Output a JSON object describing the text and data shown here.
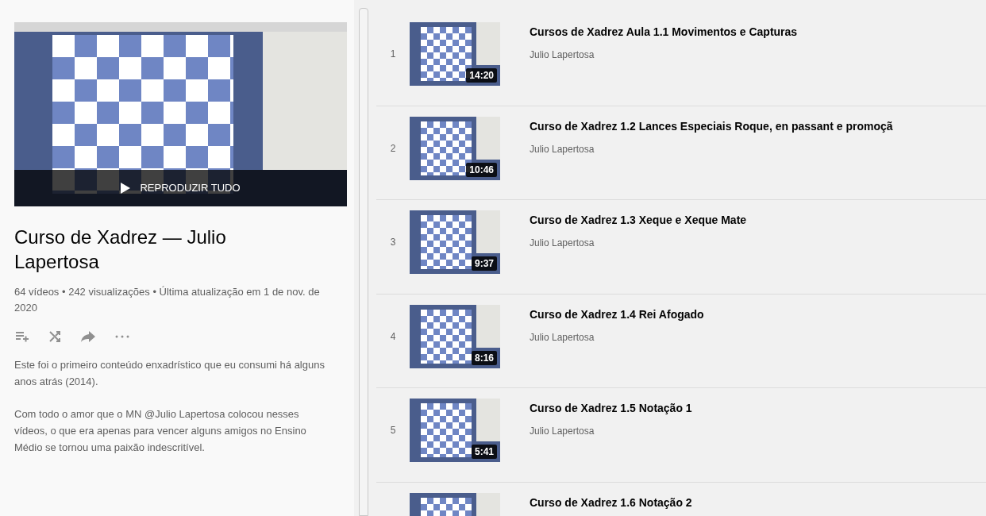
{
  "playlist": {
    "play_all": "REPRODUZIR TUDO",
    "title": "Curso de Xadrez — Julio Lapertosa",
    "stats": "64 vídeos • 242 visualizações • Última atualização em 1 de nov. de 2020",
    "description": [
      "Este foi o primeiro conteúdo enxadrístico que eu consumi há alguns anos atrás (2014).",
      "Com todo o amor que o MN @Julio Lapertosa colocou nesses vídeos, o que era apenas para vencer alguns amigos no Ensino Médio se tornou uma paixão indescritível."
    ]
  },
  "videos": [
    {
      "index": "1",
      "title": "Cursos de Xadrez Aula 1.1 Movimentos e Capturas",
      "channel": "Julio Lapertosa",
      "duration": "14:20"
    },
    {
      "index": "2",
      "title": "Curso de Xadrez 1.2 Lances Especiais Roque, en passant e promoçã",
      "channel": "Julio Lapertosa",
      "duration": "10:46"
    },
    {
      "index": "3",
      "title": "Curso de Xadrez 1.3 Xeque e Xeque Mate",
      "channel": "Julio Lapertosa",
      "duration": "9:37"
    },
    {
      "index": "4",
      "title": "Curso de Xadrez 1.4 Rei Afogado",
      "channel": "Julio Lapertosa",
      "duration": "8:16"
    },
    {
      "index": "5",
      "title": "Curso de Xadrez 1.5 Notação 1",
      "channel": "Julio Lapertosa",
      "duration": "5:41"
    },
    {
      "title": "Curso de Xadrez 1.6 Notação 2"
    }
  ]
}
